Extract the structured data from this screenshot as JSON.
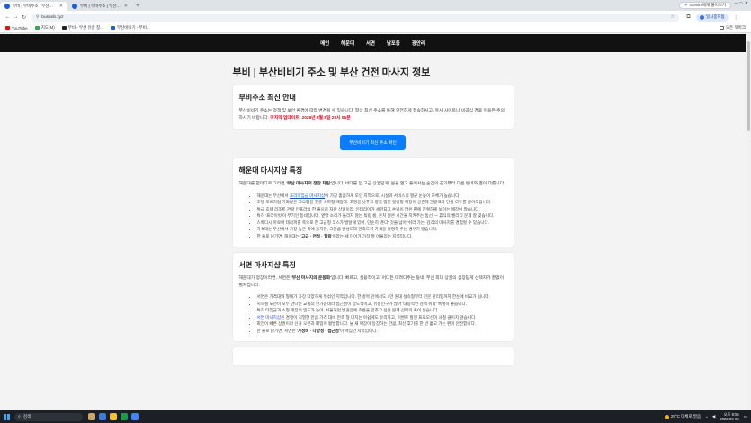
{
  "browser": {
    "tabs": [
      {
        "title": "부비 | 부비주소 | 부산비비기 주...",
        "active": true
      },
      {
        "title": "부비 | 부비주소 | 부산비비기 주...",
        "active": false
      }
    ],
    "gemini_label": "Gemini에게 물어보기",
    "url": "busanb.xyz",
    "profile_label": "일시중지됨",
    "bookmarks": [
      "YouTube",
      "지도(M)",
      "부비 - 부산 유흥 정...",
      "부산비비기 - 부비..."
    ],
    "all_bookmarks": "모든 북마크"
  },
  "nav": {
    "items": [
      "메인",
      "해운대",
      "서면",
      "남포동",
      "광안리"
    ]
  },
  "page": {
    "title": "부비 | 부산비비기 주소 및 부산 건전 마사지 정보",
    "notice": {
      "heading": "부비주소 최신 안내",
      "text": "부산비비기 주소는 정책 및 보안 환경에 따라 변경될 수 있습니다. 항상 최신 주소를 통해 안전하게 접속하시고, 유사 사이트나 비공식 경로 이용은 주의하시기 바랍니다.",
      "updated": "마지막 업데이트: 2026년 8월 6일 20시 05분"
    },
    "cta_label": "부산비비기 최신 주소 확인",
    "haeundae": {
      "heading": "해운대 마사지샵 특징",
      "intro_a": "해운대를 한마디로 그리면 '",
      "intro_bold": "부산 마사지의 정장 차림",
      "intro_b": "'입니다. 바다를 낀 고급 상권답게, 문을 열고 들어서는 순간의 공기부터 다른 동네와 결이 다릅니다.",
      "items": [
        {
          "a": "해운대는 부산에서 ",
          "link": "프리미엄급 마사지샵",
          "b": "이 가장 촘촘하게 모인 지역으로, 시설과 서비스의 평균 눈높이 자체가 높습니다."
        },
        {
          "a": "호텔 로비처럼 가라앉은 고요함을 갖춘 스파형 매장과, 조명을 낮추고 향을 입힌 힐링형 매장이 공존해 관광객과 단골 모두를 끌어모읍니다."
        },
        {
          "a": "특급 호텔 리조트 관광 인프라의 한 줄으로 자란 상권이라, 인테리어가 세련되고 손님이 많은 편에 친절하게 보이는 매장이 많습니다."
        },
        {
          "a": "특히 '프라이빗'이 무기인 동네입니다. 옆방 소리가 들리지 않는 독립 룸, 흔치 않은 시간을 지켜주는 동선 — 휴식의 퀄리티 문제 잘 맞습니다."
        },
        {
          "a": "스웨디시 아로마 테라피를 축으로 한 고급형 코스가 발달해 있어, 단순히 '푼다' 것을 넘어 '쉬러 가는' 감각의 마사지를 경험할 수 있습니다."
        },
        {
          "a": "가격대는 부산에서 가장 높은 축에 들지만, 그만큼 완성도와 만족도가 가격을 설명해 주는 경우가 많습니다."
        },
        {
          "a": "한 줄로 남기면, 해운대는 '",
          "bold": "고급 · 연정 · 힐링",
          "b": "'이라는 세 단어가 가장 잘 어울리는 지역입니다."
        }
      ]
    },
    "seomyeon": {
      "heading": "서면 마사지샵 특징",
      "intro_a": "해운대가 정장이라면, 서면은 '",
      "intro_bold": "부산 마사지의 운동화",
      "intro_b": "'입니다. 빠르고, 실용적이고, 어디든 데려다주는 동네. 부산 최대 상권의 심장답게 선택지가 끝없이 펼쳐집니다.",
      "items": [
        {
          "a": "서면은 가격대와 형태가 가장 다양하게 뒤섞인 지역입니다. 한 골목 안에서도 4만 원대 실속형부터 전문 관리형까지 한눈에 비교가 됩니다."
        },
        {
          "a": "지하철 노선이 모두 만나는 교통의 한가운데라 접근성이 압도적이고, 유동인구가 많아 '대중적인 검색 취향' 특별히 좋습니다."
        },
        {
          "a": "특히 타임급과 소형 매장의 밀도가 높아, 서울처럼 발걸음에 흐름을 맞추고 싶은 분께 선택의 폭이 넓습니다."
        },
        {
          "a": "",
          "link": "서면 마사지샵",
          "b": "은 경쟁이 치열한 만큼 가격 대비 만족 형 미지는 아쉽게도 유리하고, 이벤트 할인 프로모션이 사철 끊이지 않습니다."
        },
        {
          "a": "회전이 빠른 상권이라 신규 오픈과 폐업이 활발합니다. 늘 새 매장이 등장하는 만큼, 최신 후기를 한 번 훑고 가는 편이 안전합니다."
        },
        {
          "a": "한 줄로 남기면, 서면은 '",
          "bold": "가성비 · 다양성 · 접근성",
          "b": "'이 핵심인 지역입니다."
        }
      ]
    }
  },
  "taskbar": {
    "search_placeholder": "검색",
    "weather": "29°C 대체로 맑음",
    "time": "오후 8:55",
    "date": "2026-08-06"
  }
}
